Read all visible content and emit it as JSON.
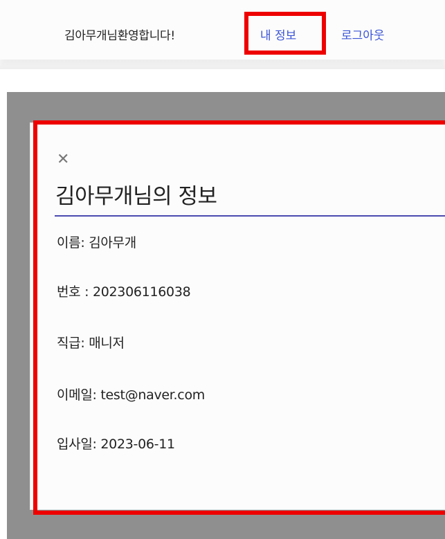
{
  "header": {
    "welcome_text": "김아무개님환영합니다!",
    "my_info_link": "내 정보",
    "logout_link": "로그아웃"
  },
  "modal": {
    "close_label": "✕",
    "title": "김아무개님의 정보",
    "fields": [
      {
        "text": "이름: 김아무개"
      },
      {
        "text": "번호 : 202306116038"
      },
      {
        "text": "직급: 매니저"
      },
      {
        "text": "이메일: test@naver.com"
      },
      {
        "text": "입사일: 2023-06-11"
      }
    ]
  },
  "colors": {
    "link": "#3b54d6",
    "highlight": "#ee0000",
    "overlay": "#8f8f8f",
    "title_underline": "#4a4ab0"
  }
}
